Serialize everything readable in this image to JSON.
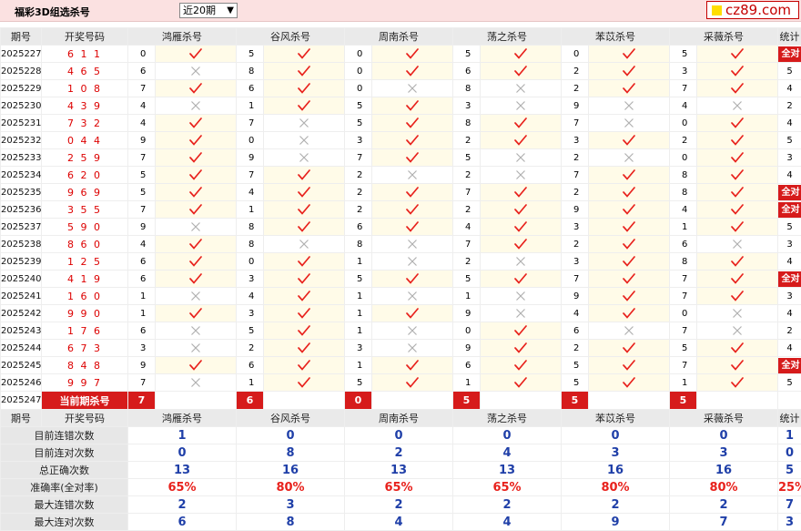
{
  "header": {
    "title": "福彩3D组选杀号",
    "period_select": "近20期",
    "logo_text": "cz89.com"
  },
  "columns": {
    "period": "期号",
    "numbers": "开奖号码",
    "methods": [
      "鸿雁杀号",
      "谷风杀号",
      "周南杀号",
      "荡之杀号",
      "苯苡杀号",
      "采薇杀号"
    ],
    "stats": "统计"
  },
  "rows": [
    {
      "period": "2025227",
      "numbers": "6 1 1",
      "kills": [
        0,
        5,
        0,
        5,
        0,
        5
      ],
      "ok": [
        true,
        true,
        true,
        true,
        true,
        true
      ],
      "stat": "全对"
    },
    {
      "period": "2025228",
      "numbers": "4 6 5",
      "kills": [
        6,
        8,
        0,
        6,
        2,
        3
      ],
      "ok": [
        false,
        true,
        true,
        true,
        true,
        true
      ],
      "stat": "5"
    },
    {
      "period": "2025229",
      "numbers": "1 0 8",
      "kills": [
        7,
        6,
        0,
        8,
        2,
        7
      ],
      "ok": [
        true,
        true,
        false,
        false,
        true,
        true
      ],
      "stat": "4"
    },
    {
      "period": "2025230",
      "numbers": "4 3 9",
      "kills": [
        4,
        1,
        5,
        3,
        9,
        4
      ],
      "ok": [
        false,
        true,
        true,
        false,
        false,
        false
      ],
      "stat": "2"
    },
    {
      "period": "2025231",
      "numbers": "7 3 2",
      "kills": [
        4,
        7,
        5,
        8,
        7,
        0
      ],
      "ok": [
        true,
        false,
        true,
        true,
        false,
        true
      ],
      "stat": "4"
    },
    {
      "period": "2025232",
      "numbers": "0 4 4",
      "kills": [
        9,
        0,
        3,
        2,
        3,
        2
      ],
      "ok": [
        true,
        false,
        true,
        true,
        true,
        true
      ],
      "stat": "5"
    },
    {
      "period": "2025233",
      "numbers": "2 5 9",
      "kills": [
        7,
        9,
        7,
        5,
        2,
        0
      ],
      "ok": [
        true,
        false,
        true,
        false,
        false,
        true
      ],
      "stat": "3"
    },
    {
      "period": "2025234",
      "numbers": "6 2 0",
      "kills": [
        5,
        7,
        2,
        2,
        7,
        8
      ],
      "ok": [
        true,
        true,
        false,
        false,
        true,
        true
      ],
      "stat": "4"
    },
    {
      "period": "2025235",
      "numbers": "9 6 9",
      "kills": [
        5,
        4,
        2,
        7,
        2,
        8
      ],
      "ok": [
        true,
        true,
        true,
        true,
        true,
        true
      ],
      "stat": "全对"
    },
    {
      "period": "2025236",
      "numbers": "3 5 5",
      "kills": [
        7,
        1,
        2,
        2,
        9,
        4
      ],
      "ok": [
        true,
        true,
        true,
        true,
        true,
        true
      ],
      "stat": "全对"
    },
    {
      "period": "2025237",
      "numbers": "5 9 0",
      "kills": [
        9,
        8,
        6,
        4,
        3,
        1
      ],
      "ok": [
        false,
        true,
        true,
        true,
        true,
        true
      ],
      "stat": "5"
    },
    {
      "period": "2025238",
      "numbers": "8 6 0",
      "kills": [
        4,
        8,
        8,
        7,
        2,
        6
      ],
      "ok": [
        true,
        false,
        false,
        true,
        true,
        false
      ],
      "stat": "3"
    },
    {
      "period": "2025239",
      "numbers": "1 2 5",
      "kills": [
        6,
        0,
        1,
        2,
        3,
        8
      ],
      "ok": [
        true,
        true,
        false,
        false,
        true,
        true
      ],
      "stat": "4"
    },
    {
      "period": "2025240",
      "numbers": "4 1 9",
      "kills": [
        6,
        3,
        5,
        5,
        7,
        7
      ],
      "ok": [
        true,
        true,
        true,
        true,
        true,
        true
      ],
      "stat": "全对"
    },
    {
      "period": "2025241",
      "numbers": "1 6 0",
      "kills": [
        1,
        4,
        1,
        1,
        9,
        7
      ],
      "ok": [
        false,
        true,
        false,
        false,
        true,
        true
      ],
      "stat": "3"
    },
    {
      "period": "2025242",
      "numbers": "9 9 0",
      "kills": [
        1,
        3,
        1,
        9,
        4,
        0
      ],
      "ok": [
        true,
        true,
        true,
        false,
        true,
        false
      ],
      "stat": "4"
    },
    {
      "period": "2025243",
      "numbers": "1 7 6",
      "kills": [
        6,
        5,
        1,
        0,
        6,
        7
      ],
      "ok": [
        false,
        true,
        false,
        true,
        false,
        false
      ],
      "stat": "2"
    },
    {
      "period": "2025244",
      "numbers": "6 7 3",
      "kills": [
        3,
        2,
        3,
        9,
        2,
        5
      ],
      "ok": [
        false,
        true,
        false,
        true,
        true,
        true
      ],
      "stat": "4"
    },
    {
      "period": "2025245",
      "numbers": "8 4 8",
      "kills": [
        9,
        6,
        1,
        6,
        5,
        7
      ],
      "ok": [
        true,
        true,
        true,
        true,
        true,
        true
      ],
      "stat": "全对"
    },
    {
      "period": "2025246",
      "numbers": "9 9 7",
      "kills": [
        7,
        1,
        5,
        1,
        5,
        1
      ],
      "ok": [
        false,
        true,
        true,
        true,
        true,
        true
      ],
      "stat": "5"
    }
  ],
  "current": {
    "period": "2025247",
    "label": "当前期杀号",
    "kills": [
      "7",
      "6",
      "0",
      "5",
      "5",
      "5"
    ]
  },
  "stats": [
    {
      "label": "目前连错次数",
      "values": [
        "1",
        "0",
        "0",
        "0",
        "0",
        "0"
      ],
      "total": "1",
      "red": false
    },
    {
      "label": "目前连对次数",
      "values": [
        "0",
        "8",
        "2",
        "4",
        "3",
        "3"
      ],
      "total": "0",
      "red": false
    },
    {
      "label": "总正确次数",
      "values": [
        "13",
        "16",
        "13",
        "13",
        "16",
        "16"
      ],
      "total": "5",
      "red": false
    },
    {
      "label": "准确率(全对率)",
      "values": [
        "65%",
        "80%",
        "65%",
        "65%",
        "80%",
        "80%"
      ],
      "total": "25%",
      "red": true
    },
    {
      "label": "最大连错次数",
      "values": [
        "2",
        "3",
        "2",
        "2",
        "2",
        "2"
      ],
      "total": "7",
      "red": false
    },
    {
      "label": "最大连对次数",
      "values": [
        "6",
        "8",
        "4",
        "4",
        "9",
        "7"
      ],
      "total": "3",
      "red": false
    }
  ],
  "colors": {
    "accent": "#d61b1b",
    "check": "#e8211c",
    "cross": "#b0b0b0",
    "stat_blue": "#1f3fa8",
    "yes_bg": "#fffbe8"
  }
}
